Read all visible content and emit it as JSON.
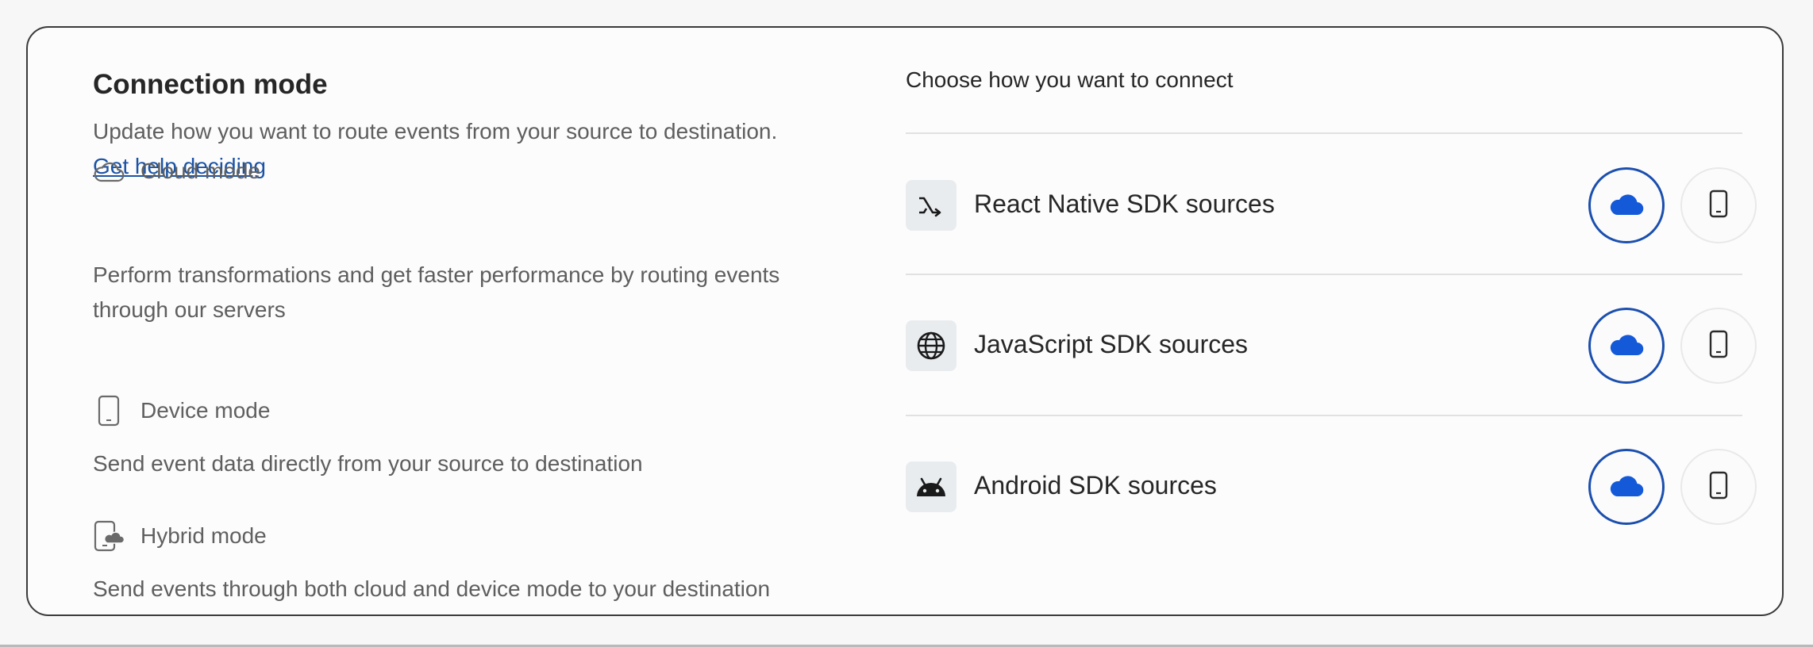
{
  "connection": {
    "title": "Connection mode",
    "description": "Update how you want to route events from your source to destination.",
    "help_link": "Get help deciding"
  },
  "modes": [
    {
      "name": "Cloud mode",
      "icon": "cloud-outline-icon",
      "description": "Perform transformations and get faster performance by routing events through our servers"
    },
    {
      "name": "Device mode",
      "icon": "phone-outline-icon",
      "description": "Send event data directly from your source to destination"
    },
    {
      "name": "Hybrid mode",
      "icon": "phone-cloud-icon",
      "description": "Send events through both cloud and device mode to your destination"
    }
  ],
  "sources": {
    "heading": "Choose how you want to connect",
    "items": [
      {
        "label": "React Native SDK sources",
        "icon": "react-native-icon",
        "selected": "cloud"
      },
      {
        "label": "JavaScript SDK sources",
        "icon": "globe-icon",
        "selected": "cloud"
      },
      {
        "label": "Android SDK sources",
        "icon": "android-icon",
        "selected": "cloud"
      }
    ]
  },
  "colors": {
    "accent": "#1b4fae",
    "cloud_fill": "#1459d8",
    "link": "#1b53a6",
    "border": "#3a3a3a"
  }
}
